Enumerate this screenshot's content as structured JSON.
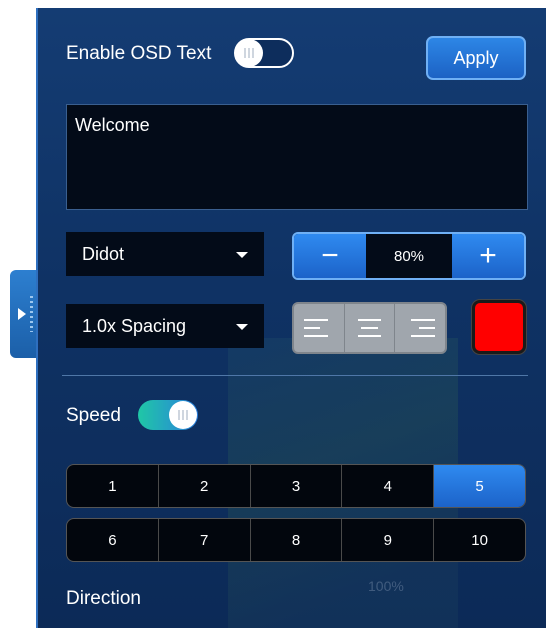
{
  "osd": {
    "enable_label": "Enable OSD Text",
    "enable_toggle": false,
    "apply_label": "Apply",
    "text_value": "Welcome"
  },
  "font": {
    "family_value": "Didot",
    "size_value": "80%",
    "minus_label": "−",
    "plus_label": "+",
    "spacing_value": "1.0x Spacing",
    "color": "#ff0000"
  },
  "alignment": [
    "align-left",
    "align-center",
    "align-right"
  ],
  "speed": {
    "label": "Speed",
    "toggle": true,
    "row1": [
      "1",
      "2",
      "3",
      "4",
      "5"
    ],
    "row2": [
      "6",
      "7",
      "8",
      "9",
      "10"
    ],
    "selected": "5"
  },
  "direction": {
    "label": "Direction"
  },
  "background": {
    "zoom_text": "100%"
  }
}
